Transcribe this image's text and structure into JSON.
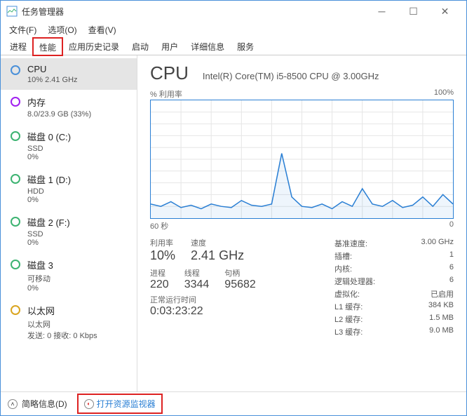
{
  "window": {
    "title": "任务管理器"
  },
  "menus": [
    "文件(F)",
    "选项(O)",
    "查看(V)"
  ],
  "tabs": [
    "进程",
    "性能",
    "应用历史记录",
    "启动",
    "用户",
    "详细信息",
    "服务"
  ],
  "activeTab": 1,
  "sidebar": [
    {
      "name": "CPU",
      "line1": "10% 2.41 GHz",
      "icon": "cpu",
      "selected": true
    },
    {
      "name": "内存",
      "line1": "8.0/23.9 GB (33%)",
      "icon": "mem"
    },
    {
      "name": "磁盘 0 (C:)",
      "line1": "SSD",
      "line2": "0%",
      "icon": "disk"
    },
    {
      "name": "磁盘 1 (D:)",
      "line1": "HDD",
      "line2": "0%",
      "icon": "disk"
    },
    {
      "name": "磁盘 2 (F:)",
      "line1": "SSD",
      "line2": "0%",
      "icon": "disk"
    },
    {
      "name": "磁盘 3",
      "line1": "可移动",
      "line2": "0%",
      "icon": "disk"
    },
    {
      "name": "以太网",
      "line1": "以太网",
      "line2": "发送: 0 接收: 0 Kbps",
      "icon": "net"
    }
  ],
  "main": {
    "title": "CPU",
    "subtitle": "Intel(R) Core(TM) i5-8500 CPU @ 3.00GHz",
    "chartLabelLeft": "% 利用率",
    "chartLabelRight": "100%",
    "xLeft": "60 秒",
    "xRight": "0",
    "big": [
      {
        "lbl": "利用率",
        "val": "10%"
      },
      {
        "lbl": "速度",
        "val": "2.41 GHz"
      }
    ],
    "mid": [
      {
        "lbl": "进程",
        "val": "220"
      },
      {
        "lbl": "线程",
        "val": "3344"
      },
      {
        "lbl": "句柄",
        "val": "95682"
      }
    ],
    "uptime": {
      "lbl": "正常运行时间",
      "val": "0:03:23:22"
    },
    "right": [
      {
        "k": "基准速度:",
        "v": "3.00 GHz"
      },
      {
        "k": "插槽:",
        "v": "1"
      },
      {
        "k": "内核:",
        "v": "6"
      },
      {
        "k": "逻辑处理器:",
        "v": "6"
      },
      {
        "k": "虚拟化:",
        "v": "已启用"
      },
      {
        "k": "L1 缓存:",
        "v": "384 KB"
      },
      {
        "k": "L2 缓存:",
        "v": "1.5 MB"
      },
      {
        "k": "L3 缓存:",
        "v": "9.0 MB"
      }
    ]
  },
  "footer": {
    "less": "简略信息(D)",
    "resmon": "打开资源监视器"
  },
  "chart_data": {
    "type": "line",
    "title": "% 利用率",
    "xlabel": "60 秒 → 0",
    "ylabel": "% 利用率",
    "ylim": [
      0,
      100
    ],
    "x": [
      60,
      58,
      56,
      54,
      52,
      50,
      48,
      46,
      44,
      42,
      40,
      38,
      36,
      34,
      32,
      30,
      28,
      26,
      24,
      22,
      20,
      18,
      16,
      14,
      12,
      10,
      8,
      6,
      4,
      2,
      0
    ],
    "values": [
      12,
      10,
      14,
      9,
      11,
      8,
      12,
      10,
      9,
      15,
      11,
      10,
      12,
      55,
      18,
      10,
      9,
      12,
      8,
      14,
      10,
      25,
      12,
      10,
      15,
      9,
      11,
      18,
      10,
      20,
      12
    ]
  }
}
